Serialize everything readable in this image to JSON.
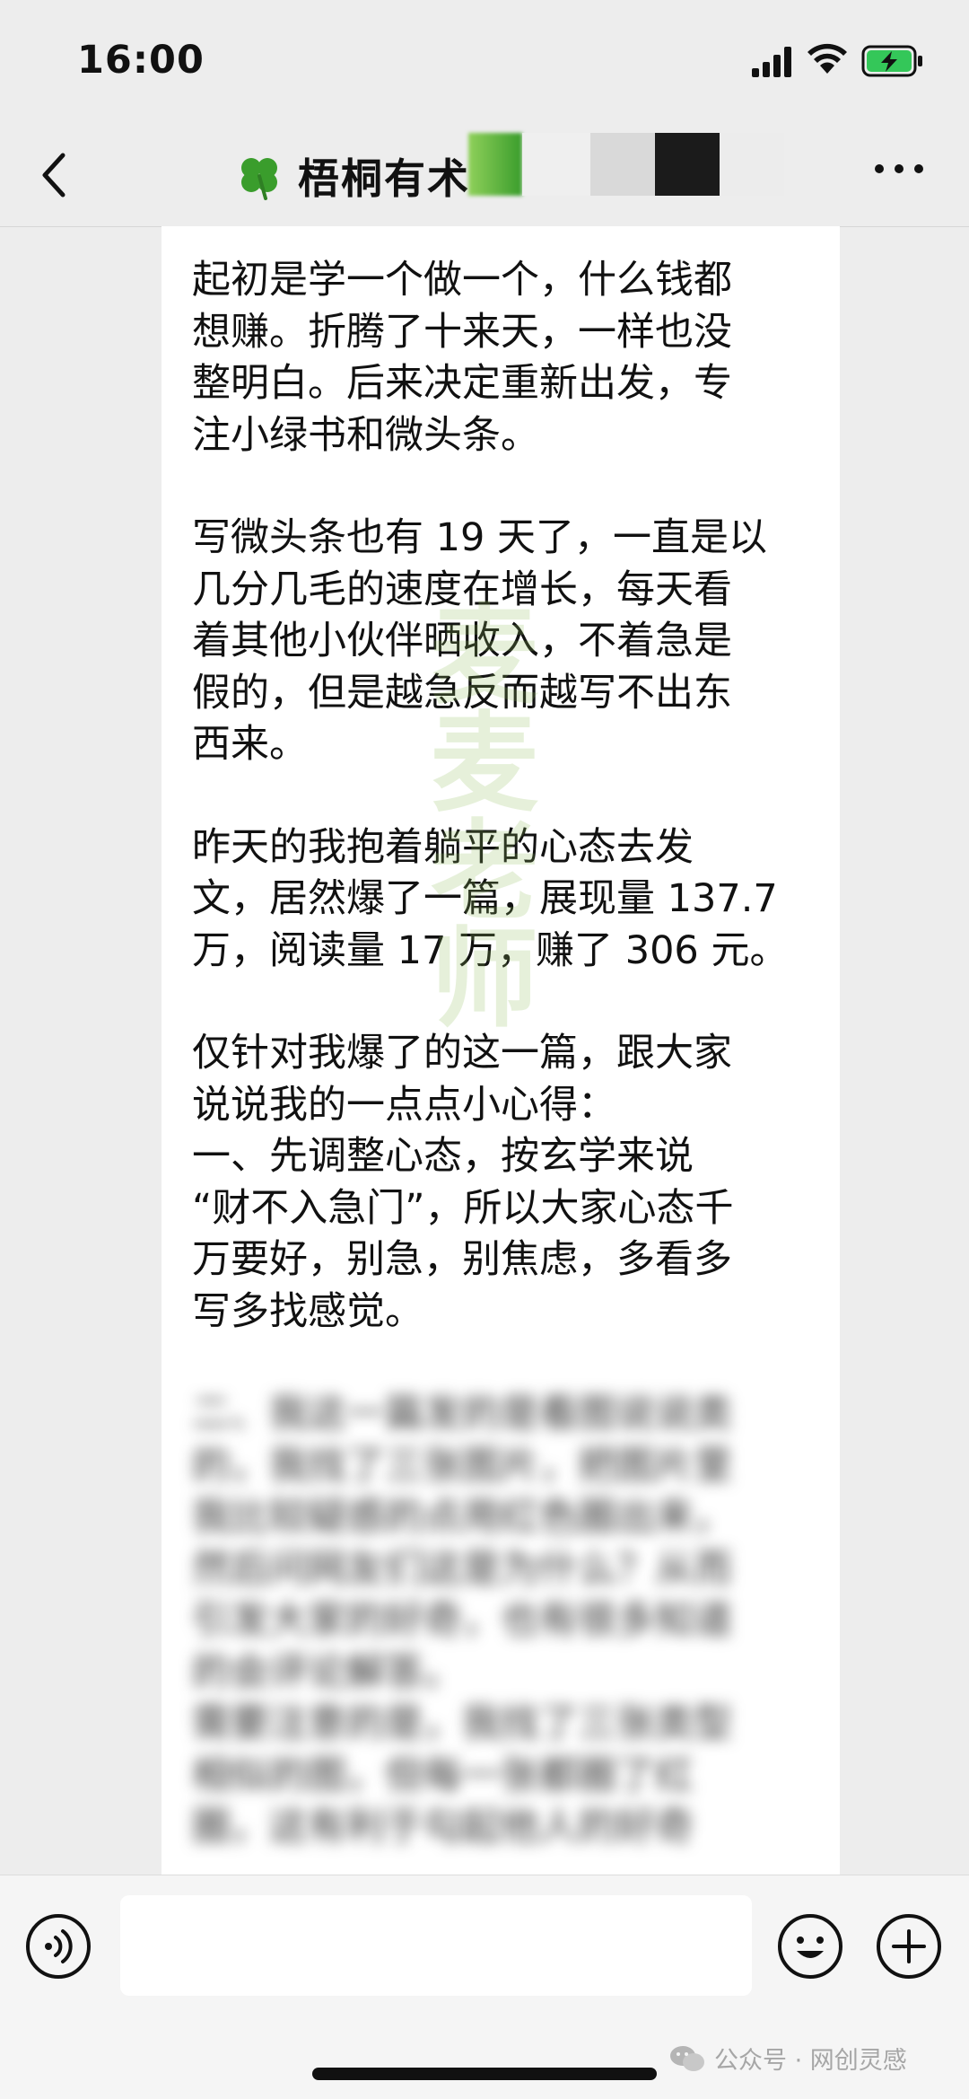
{
  "status_bar": {
    "time": "16:00"
  },
  "nav": {
    "title": "梧桐有术"
  },
  "message": {
    "paragraphs": [
      "起初是学一个做一个，什么钱都\n想赚。折腾了十来天，一样也没\n整明白。后来决定重新出发，专\n注小绿书和微头条。",
      "写微头条也有 19 天了，一直是以\n几分几毛的速度在增长，每天看\n着其他小伙伴晒收入，不着急是\n假的，但是越急反而越写不出东\n西来。",
      "昨天的我抱着躺平的心态去发\n文，居然爆了一篇，展现量 137.7\n万，阅读量 17 万，赚了 306 元。",
      "仅针对我爆了的这一篇，跟大家\n说说我的一点点小心得：\n一、先调整心态，按玄学来说\n“财不入急门”，所以大家心态千\n万要好，别急，别焦虑，多看多\n写多找感觉。"
    ],
    "blurred_text": "二、我这一篇发的是看图说说类\n的，我找了三张图片，把图片里\n我比较疑惑的点用红色圈出来，\n然后问网友们这是为什么？从而\n引发大家的好奇，也有很多知道\n的会评论解答。\n需要注意的是，我找了三张类型\n相似的图，但每一张都圈了红\n圈，这有利于勾起他人的好奇",
    "watermark": "麦麦老师"
  },
  "input_bar": {
    "placeholder": ""
  },
  "source_watermark": "公众号 · 网创灵感",
  "colors": {
    "background": "#ededed",
    "bubble": "#ffffff",
    "clover": "#3a9d2c",
    "battery": "#34c759"
  }
}
